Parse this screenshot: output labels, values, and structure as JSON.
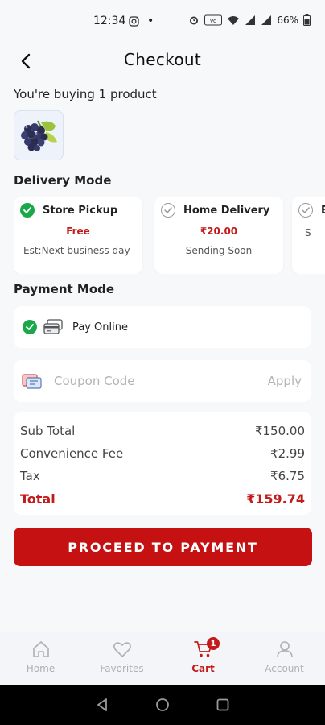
{
  "status_bar": {
    "time": "12:34",
    "battery": "66%",
    "icons": [
      "instagram-icon",
      "dot",
      "alarm-icon",
      "volte-icon",
      "wifi-icon",
      "signal-icon",
      "battery-icon"
    ]
  },
  "header": {
    "title": "Checkout",
    "back_icon": "chevron-left-icon"
  },
  "buying_text": "You're buying 1 product",
  "product": {
    "thumb_icon": "grapes-image"
  },
  "delivery": {
    "title": "Delivery Mode",
    "options": [
      {
        "name": "Store Pickup",
        "price": "Free",
        "eta": "Est:Next business day",
        "selected": true
      },
      {
        "name": "Home Delivery",
        "price": "₹20.00",
        "eta": "Sending Soon",
        "selected": false
      },
      {
        "name": "Ex",
        "price": "",
        "eta": "S",
        "selected": false
      }
    ]
  },
  "payment": {
    "title": "Payment Mode",
    "option_label": "Pay Online",
    "icon": "card-icon"
  },
  "coupon": {
    "placeholder": "Coupon Code",
    "apply_label": "Apply",
    "icon": "coupon-icon"
  },
  "summary": {
    "rows": [
      {
        "label": "Sub Total",
        "value": "₹150.00"
      },
      {
        "label": "Convenience Fee",
        "value": "₹2.99"
      },
      {
        "label": "Tax",
        "value": "₹6.75"
      }
    ],
    "total_label": "Total",
    "total_value": "₹159.74"
  },
  "proceed_label": "PROCEED TO PAYMENT",
  "bottom_nav": {
    "items": [
      {
        "label": "Home",
        "icon": "home-icon",
        "active": false
      },
      {
        "label": "Favorites",
        "icon": "heart-icon",
        "active": false
      },
      {
        "label": "Cart",
        "icon": "cart-icon",
        "active": true,
        "badge": "1"
      },
      {
        "label": "Account",
        "icon": "user-icon",
        "active": false
      }
    ]
  },
  "colors": {
    "accent": "#c51111",
    "success": "#1aa84b",
    "background": "#f7f8fa"
  }
}
